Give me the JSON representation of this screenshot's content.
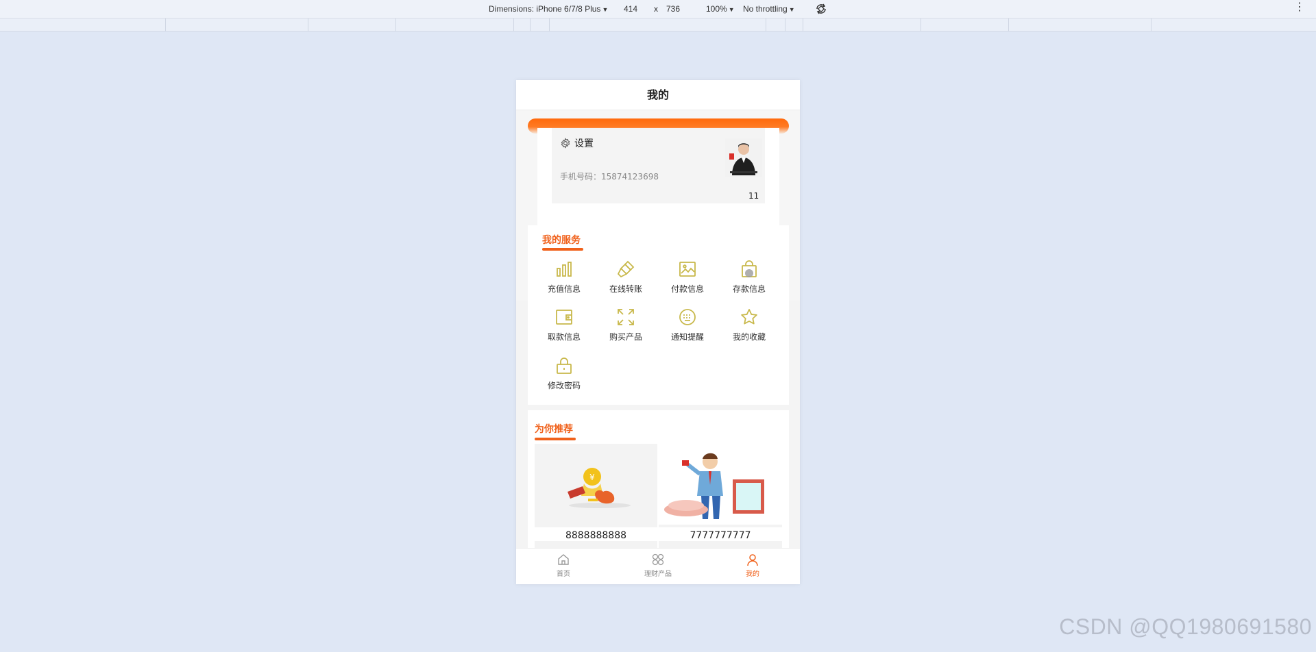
{
  "devtools": {
    "dimensions_label": "Dimensions: iPhone 6/7/8 Plus",
    "width": "414",
    "times": "x",
    "height": "736",
    "zoom": "100%",
    "throttling": "No throttling"
  },
  "page": {
    "title": "我的"
  },
  "profile": {
    "settings_label": "设置",
    "phone_label": "手机号码：15874123698",
    "username": "11"
  },
  "services": {
    "title": "我的服务",
    "items": [
      {
        "label": "充值信息",
        "icon": "bar-chart-icon"
      },
      {
        "label": "在线转账",
        "icon": "brush-icon"
      },
      {
        "label": "付款信息",
        "icon": "image-icon"
      },
      {
        "label": "存款信息",
        "icon": "bag-icon"
      },
      {
        "label": "取款信息",
        "icon": "wallet-icon"
      },
      {
        "label": "购买产品",
        "icon": "expand-icon"
      },
      {
        "label": "通知提醒",
        "icon": "keyboard-icon"
      },
      {
        "label": "我的收藏",
        "icon": "star-icon"
      },
      {
        "label": "修改密码",
        "icon": "lock-icon"
      }
    ]
  },
  "recommend": {
    "title": "为你推荐",
    "items": [
      {
        "label": "8888888888"
      },
      {
        "label": "7777777777"
      }
    ]
  },
  "tabbar": {
    "items": [
      {
        "label": "首页",
        "icon": "home-icon"
      },
      {
        "label": "理财产品",
        "icon": "grid-icon"
      },
      {
        "label": "我的",
        "icon": "user-icon"
      }
    ]
  },
  "colors": {
    "accent": "#f0611b",
    "icon": "#c8b84a",
    "background": "#dfe7f5"
  },
  "watermark": "CSDN @QQ1980691580"
}
